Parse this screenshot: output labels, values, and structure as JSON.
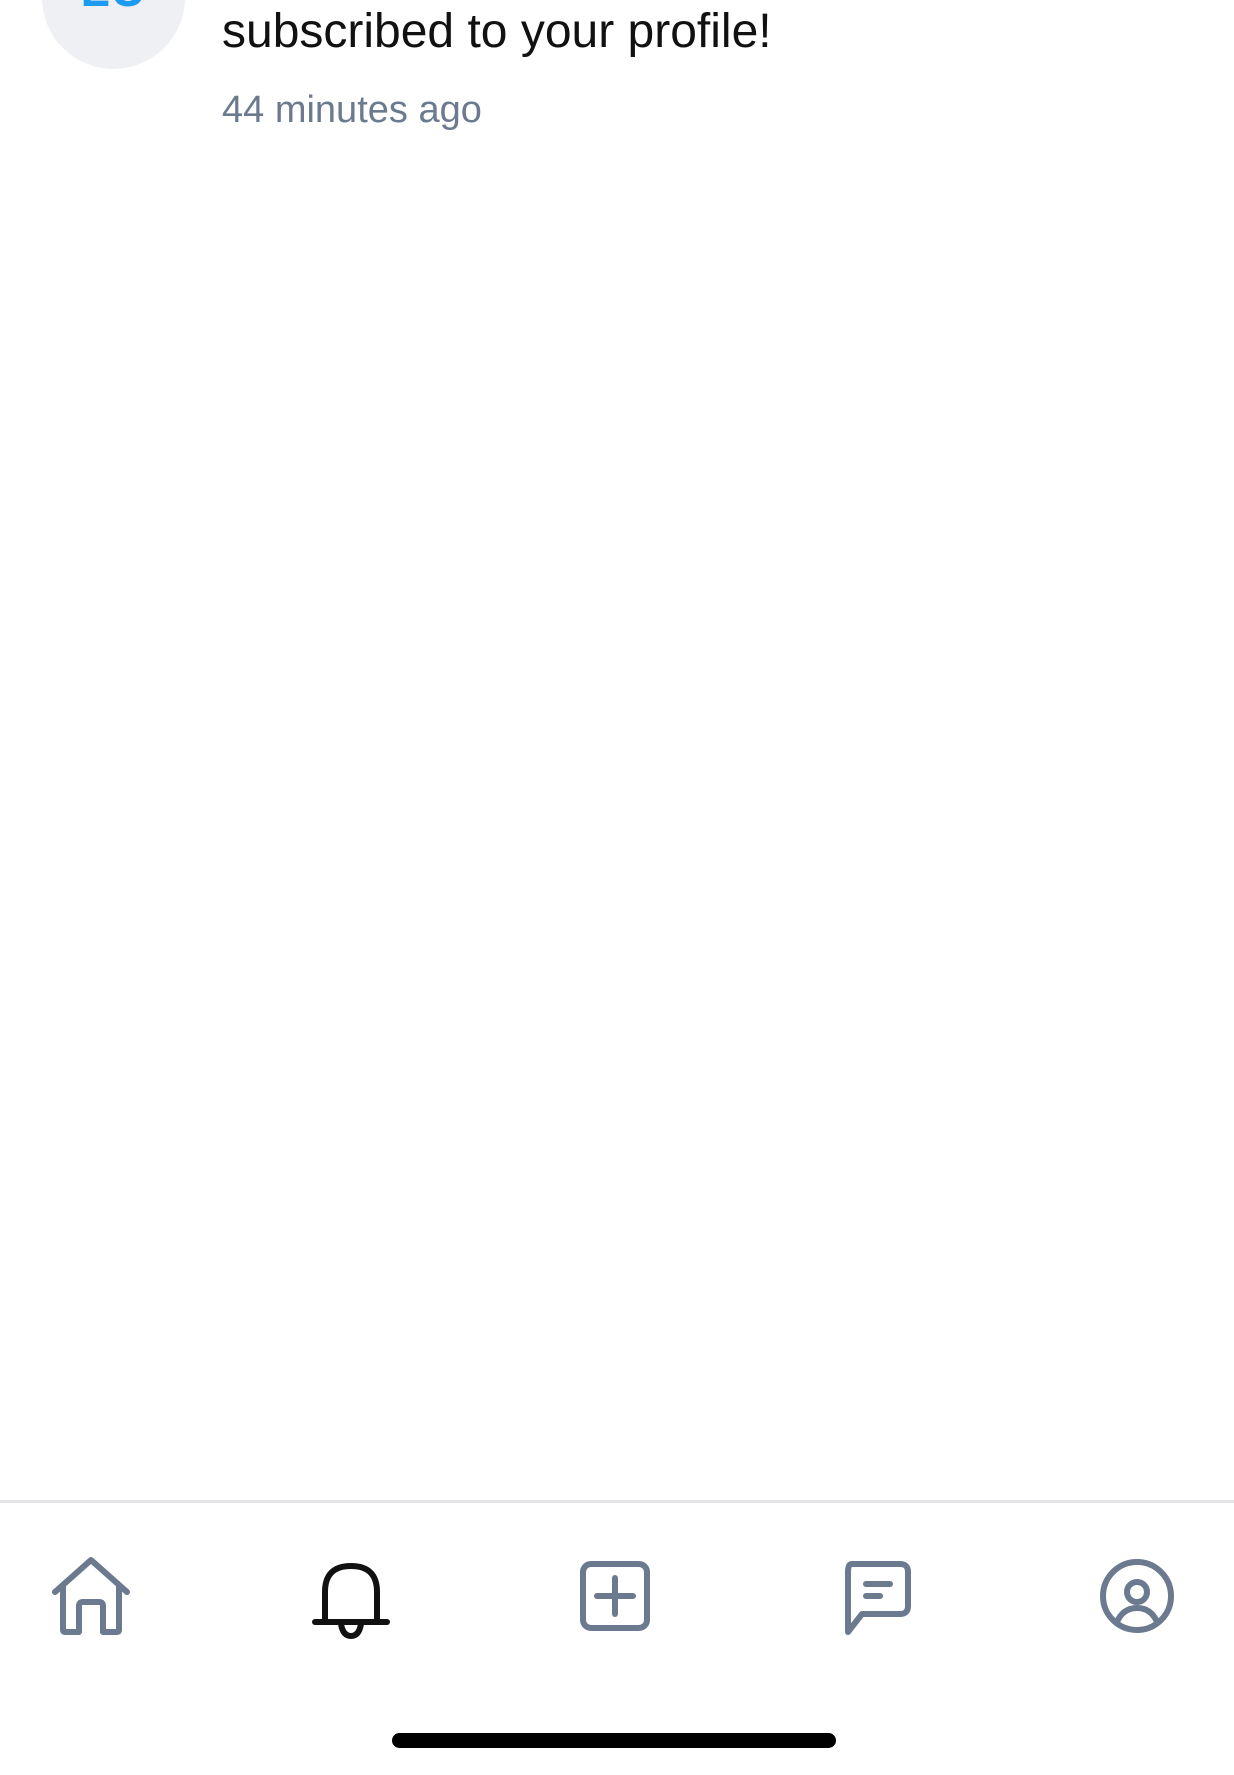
{
  "notification": {
    "avatar_initials": "LU",
    "message": "subscribed to your profile!",
    "time": "44 minutes ago"
  },
  "tabbar": {
    "active_tab": "notifications",
    "tabs": [
      {
        "id": "home",
        "icon": "home-icon"
      },
      {
        "id": "notifications",
        "icon": "bell-icon"
      },
      {
        "id": "create",
        "icon": "plus-square-icon"
      },
      {
        "id": "messages",
        "icon": "chat-icon"
      },
      {
        "id": "profile",
        "icon": "user-circle-icon"
      }
    ]
  },
  "colors": {
    "inactive_icon": "#6b7a8f",
    "active_icon": "#111111",
    "accent": "#1d9bf0",
    "avatar_bg": "#eef0f3"
  }
}
